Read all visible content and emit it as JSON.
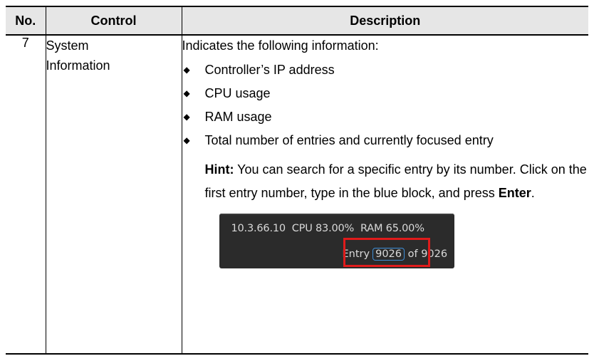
{
  "table": {
    "headers": {
      "no": "No.",
      "control": "Control",
      "description": "Description"
    },
    "row": {
      "no": "7",
      "control_line1": "System",
      "control_line2": "Information",
      "intro": "Indicates the following information:",
      "bullets": [
        "Controller’s IP address",
        "CPU usage",
        "RAM usage",
        "Total number of entries and currently focused entry"
      ],
      "hint": {
        "label": "Hint:",
        "text_before": " You can search for a specific entry by its number. Click on the first entry number, type in the blue block, and press ",
        "key": "Enter",
        "text_after": "."
      }
    }
  },
  "screenshot": {
    "ip": "10.3.66.10",
    "cpu": "CPU 83.00%",
    "ram": "RAM 65.00%",
    "entry_label": "Entry",
    "entry_current": "9026",
    "of_text": "of 9026",
    "highlight_color": "#e01b1b",
    "input_border_color": "#3f8fd8"
  }
}
